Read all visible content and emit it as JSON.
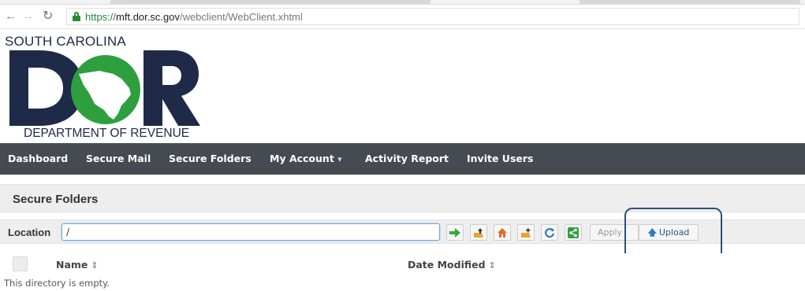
{
  "browser": {
    "url_protocol": "https://",
    "url_host": "mft.dor.sc.gov",
    "url_path": "/webclient/WebClient.xhtml"
  },
  "logo": {
    "top_text": "SOUTH CAROLINA",
    "bottom_text": "DEPARTMENT OF REVENUE",
    "colors": {
      "navy": "#1f2a48",
      "green": "#2e9f3e"
    }
  },
  "nav": {
    "items": [
      {
        "label": "Dashboard"
      },
      {
        "label": "Secure Mail"
      },
      {
        "label": "Secure Folders"
      },
      {
        "label": "My Account",
        "icon": "caret-down-icon"
      },
      {
        "label": "Activity Report"
      },
      {
        "label": "Invite Users"
      }
    ],
    "caret": "▾",
    "background": "#454b51"
  },
  "panel": {
    "title": "Secure Folders"
  },
  "toolbar": {
    "location_label": "Location",
    "location_value": "/",
    "buttons": [
      {
        "name": "go-button",
        "icon": "green-arrow-icon"
      },
      {
        "name": "parent-folder-button",
        "icon": "folder-up-icon"
      },
      {
        "name": "home-folder-button",
        "icon": "home-icon"
      },
      {
        "name": "new-folder-button",
        "icon": "new-folder-icon"
      },
      {
        "name": "refresh-button",
        "icon": "refresh-icon"
      },
      {
        "name": "share-button",
        "icon": "share-icon"
      }
    ],
    "apply_label": "Apply",
    "upload_label": "Upload",
    "upload_icon": "up-arrow-icon"
  },
  "table": {
    "columns": [
      {
        "label": "Name"
      },
      {
        "label": "Date Modified"
      }
    ],
    "sort_glyph": "⇕",
    "empty_message": "This directory is empty."
  }
}
